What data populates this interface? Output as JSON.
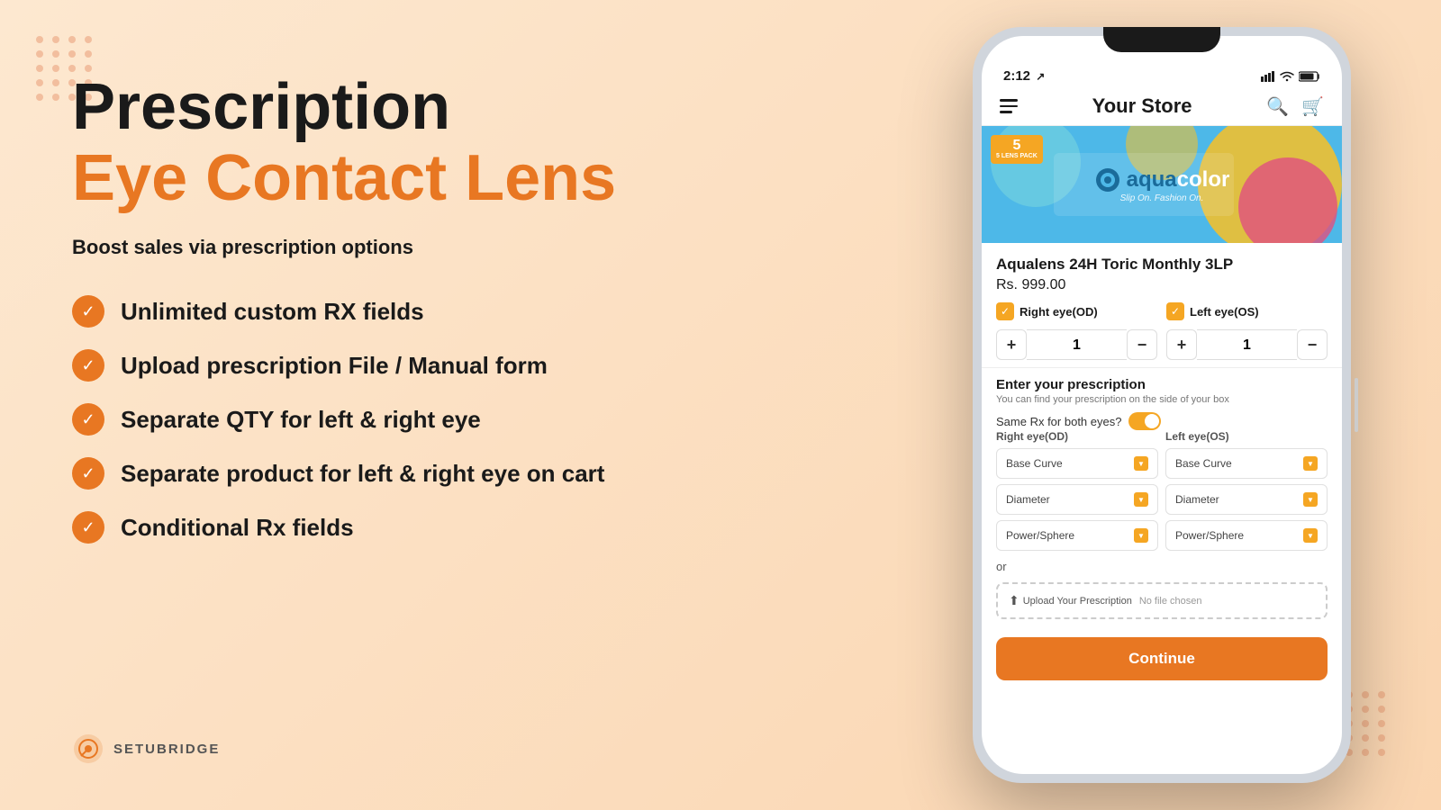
{
  "page": {
    "background_color": "#fde8d0"
  },
  "headline": {
    "line1": "Prescription",
    "line2": "Eye Contact Lens",
    "subtitle": "Boost sales via prescription options"
  },
  "features": [
    {
      "id": "f1",
      "text": "Unlimited custom RX fields"
    },
    {
      "id": "f2",
      "text": "Upload prescription File / Manual form"
    },
    {
      "id": "f3",
      "text": "Separate QTY for left & right eye"
    },
    {
      "id": "f4",
      "text": "Separate product for left & right eye on cart"
    },
    {
      "id": "f5",
      "text": "Conditional Rx fields"
    }
  ],
  "brand": {
    "name": "SETUBRIDGE"
  },
  "phone": {
    "status_bar": {
      "time": "2:12",
      "signal_icon": "signal",
      "wifi_icon": "wifi",
      "battery_icon": "battery"
    },
    "header": {
      "title": "Your Store",
      "search_icon": "search",
      "cart_icon": "cart"
    },
    "product": {
      "brand_logo": "aquacolor",
      "tagline": "Slip On. Fashion On.",
      "lens_pack": "5 LENS PACK",
      "name": "Aqualens 24H Toric Monthly 3LP",
      "price": "Rs. 999.00"
    },
    "eye_options": {
      "right": {
        "label": "Right eye(OD)",
        "checked": true
      },
      "left": {
        "label": "Left eye(OS)",
        "checked": true
      }
    },
    "qty": {
      "right": {
        "value": "1",
        "plus": "+",
        "minus": "−"
      },
      "left": {
        "value": "1",
        "plus": "+",
        "minus": "−"
      }
    },
    "prescription": {
      "title": "Enter your prescription",
      "subtitle": "You can find your prescription on the side of your box",
      "same_rx_label": "Same Rx for both eyes?",
      "right_col_label": "Right eye(OD)",
      "left_col_label": "Left eye(OS)",
      "fields": [
        {
          "name": "Base Curve"
        },
        {
          "name": "Diameter"
        },
        {
          "name": "Power/Sphere"
        }
      ],
      "or_text": "or",
      "upload_btn": "Upload Your Prescription",
      "no_file": "No file chosen"
    },
    "continue_btn": "Continue"
  }
}
